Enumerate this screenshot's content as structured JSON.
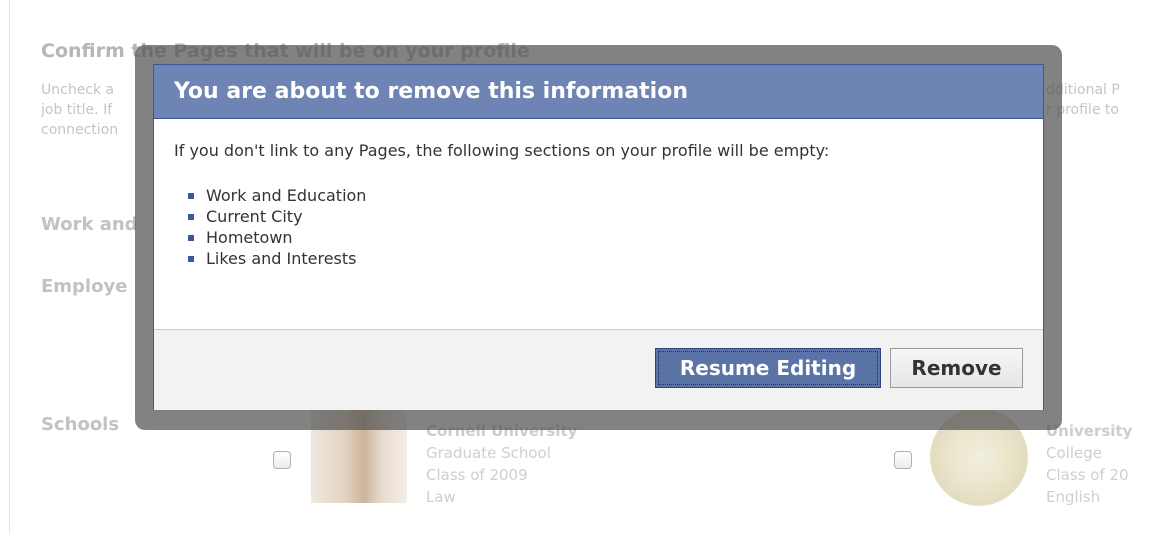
{
  "background": {
    "title": "Confirm the Pages that will be on your profile",
    "description_left": [
      "Uncheck a",
      "job title. If",
      "connection"
    ],
    "description_right": [
      "dditional P",
      "r profile to"
    ],
    "sections": {
      "work": "Work and",
      "employers": "Employe",
      "schools": "Schools"
    },
    "schools": [
      {
        "name": "Cornell University",
        "line1": "Graduate School",
        "line2": "Class of 2009",
        "line3": "Law"
      },
      {
        "name": "University",
        "line1": "College",
        "line2": "Class of 20",
        "line3": "English"
      }
    ]
  },
  "dialog": {
    "title": "You are about to remove this information",
    "message": "If you don't link to any Pages, the following sections on your profile will be empty:",
    "items": [
      "Work and Education",
      "Current City",
      "Hometown",
      "Likes and Interests"
    ],
    "buttons": {
      "resume": "Resume Editing",
      "remove": "Remove"
    }
  },
  "colors": {
    "header_blue": "#6d84b4",
    "border_blue": "#3b5998",
    "primary_button": "#5b74a8"
  }
}
